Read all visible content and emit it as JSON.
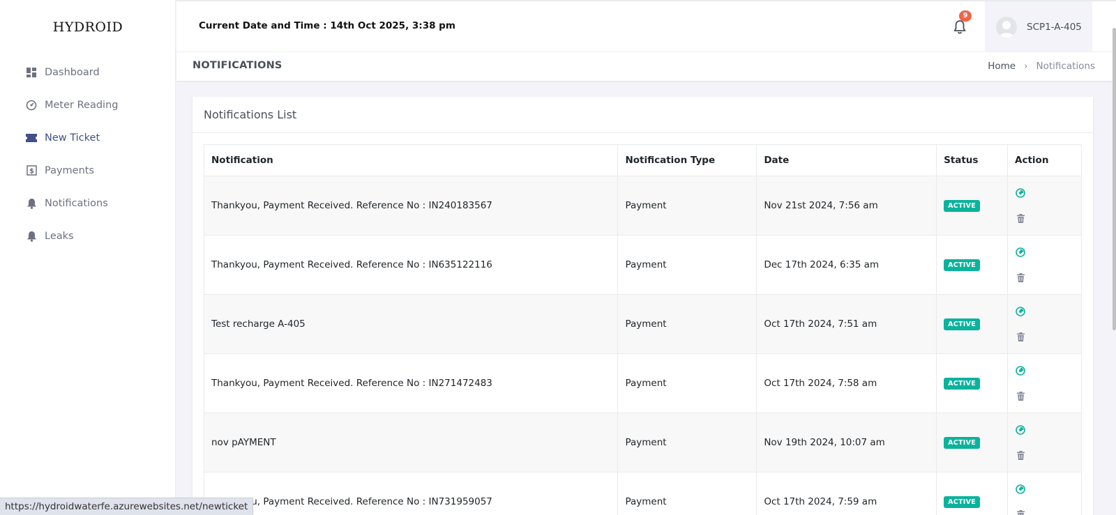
{
  "app": {
    "logo": "HYDROID"
  },
  "sidebar": {
    "items": [
      {
        "label": "Dashboard",
        "icon": "dashboard-icon"
      },
      {
        "label": "Meter Reading",
        "icon": "gauge-icon"
      },
      {
        "label": "New Ticket",
        "icon": "ticket-icon",
        "active": true
      },
      {
        "label": "Payments",
        "icon": "dollar-icon"
      },
      {
        "label": "Notifications",
        "icon": "bell-icon"
      },
      {
        "label": "Leaks",
        "icon": "bell-icon"
      }
    ]
  },
  "header": {
    "datetime": "Current Date and Time : 14th Oct 2025, 3:38 pm",
    "notification_count": "9",
    "user_name": "SCP1-A-405"
  },
  "page": {
    "title": "NOTIFICATIONS",
    "breadcrumb": {
      "home": "Home",
      "separator": "›",
      "current": "Notifications"
    }
  },
  "card": {
    "title": "Notifications List"
  },
  "table": {
    "columns": [
      "Notification",
      "Notification Type",
      "Date",
      "Status",
      "Action"
    ],
    "rows": [
      {
        "notification": "Thankyou, Payment Received. Reference No : IN240183567",
        "type": "Payment",
        "date": "Nov 21st 2024, 7:56 am",
        "status": "ACTIVE"
      },
      {
        "notification": "Thankyou, Payment Received. Reference No : IN635122116",
        "type": "Payment",
        "date": "Dec 17th 2024, 6:35 am",
        "status": "ACTIVE"
      },
      {
        "notification": "Test recharge A-405",
        "type": "Payment",
        "date": "Oct 17th 2024, 7:51 am",
        "status": "ACTIVE"
      },
      {
        "notification": "Thankyou, Payment Received. Reference No : IN271472483",
        "type": "Payment",
        "date": "Oct 17th 2024, 7:58 am",
        "status": "ACTIVE"
      },
      {
        "notification": "nov pAYMENT",
        "type": "Payment",
        "date": "Nov 19th 2024, 10:07 am",
        "status": "ACTIVE"
      },
      {
        "notification": "Thankyou, Payment Received. Reference No : IN731959057",
        "type": "Payment",
        "date": "Oct 17th 2024, 7:59 am",
        "status": "ACTIVE"
      }
    ]
  },
  "statusbar": {
    "url": "https://hydroidwaterfe.azurewebsites.net/newticket"
  },
  "colors": {
    "accent": "#405189",
    "success": "#0ab39c",
    "danger": "#f06548",
    "muted": "#878a99"
  }
}
